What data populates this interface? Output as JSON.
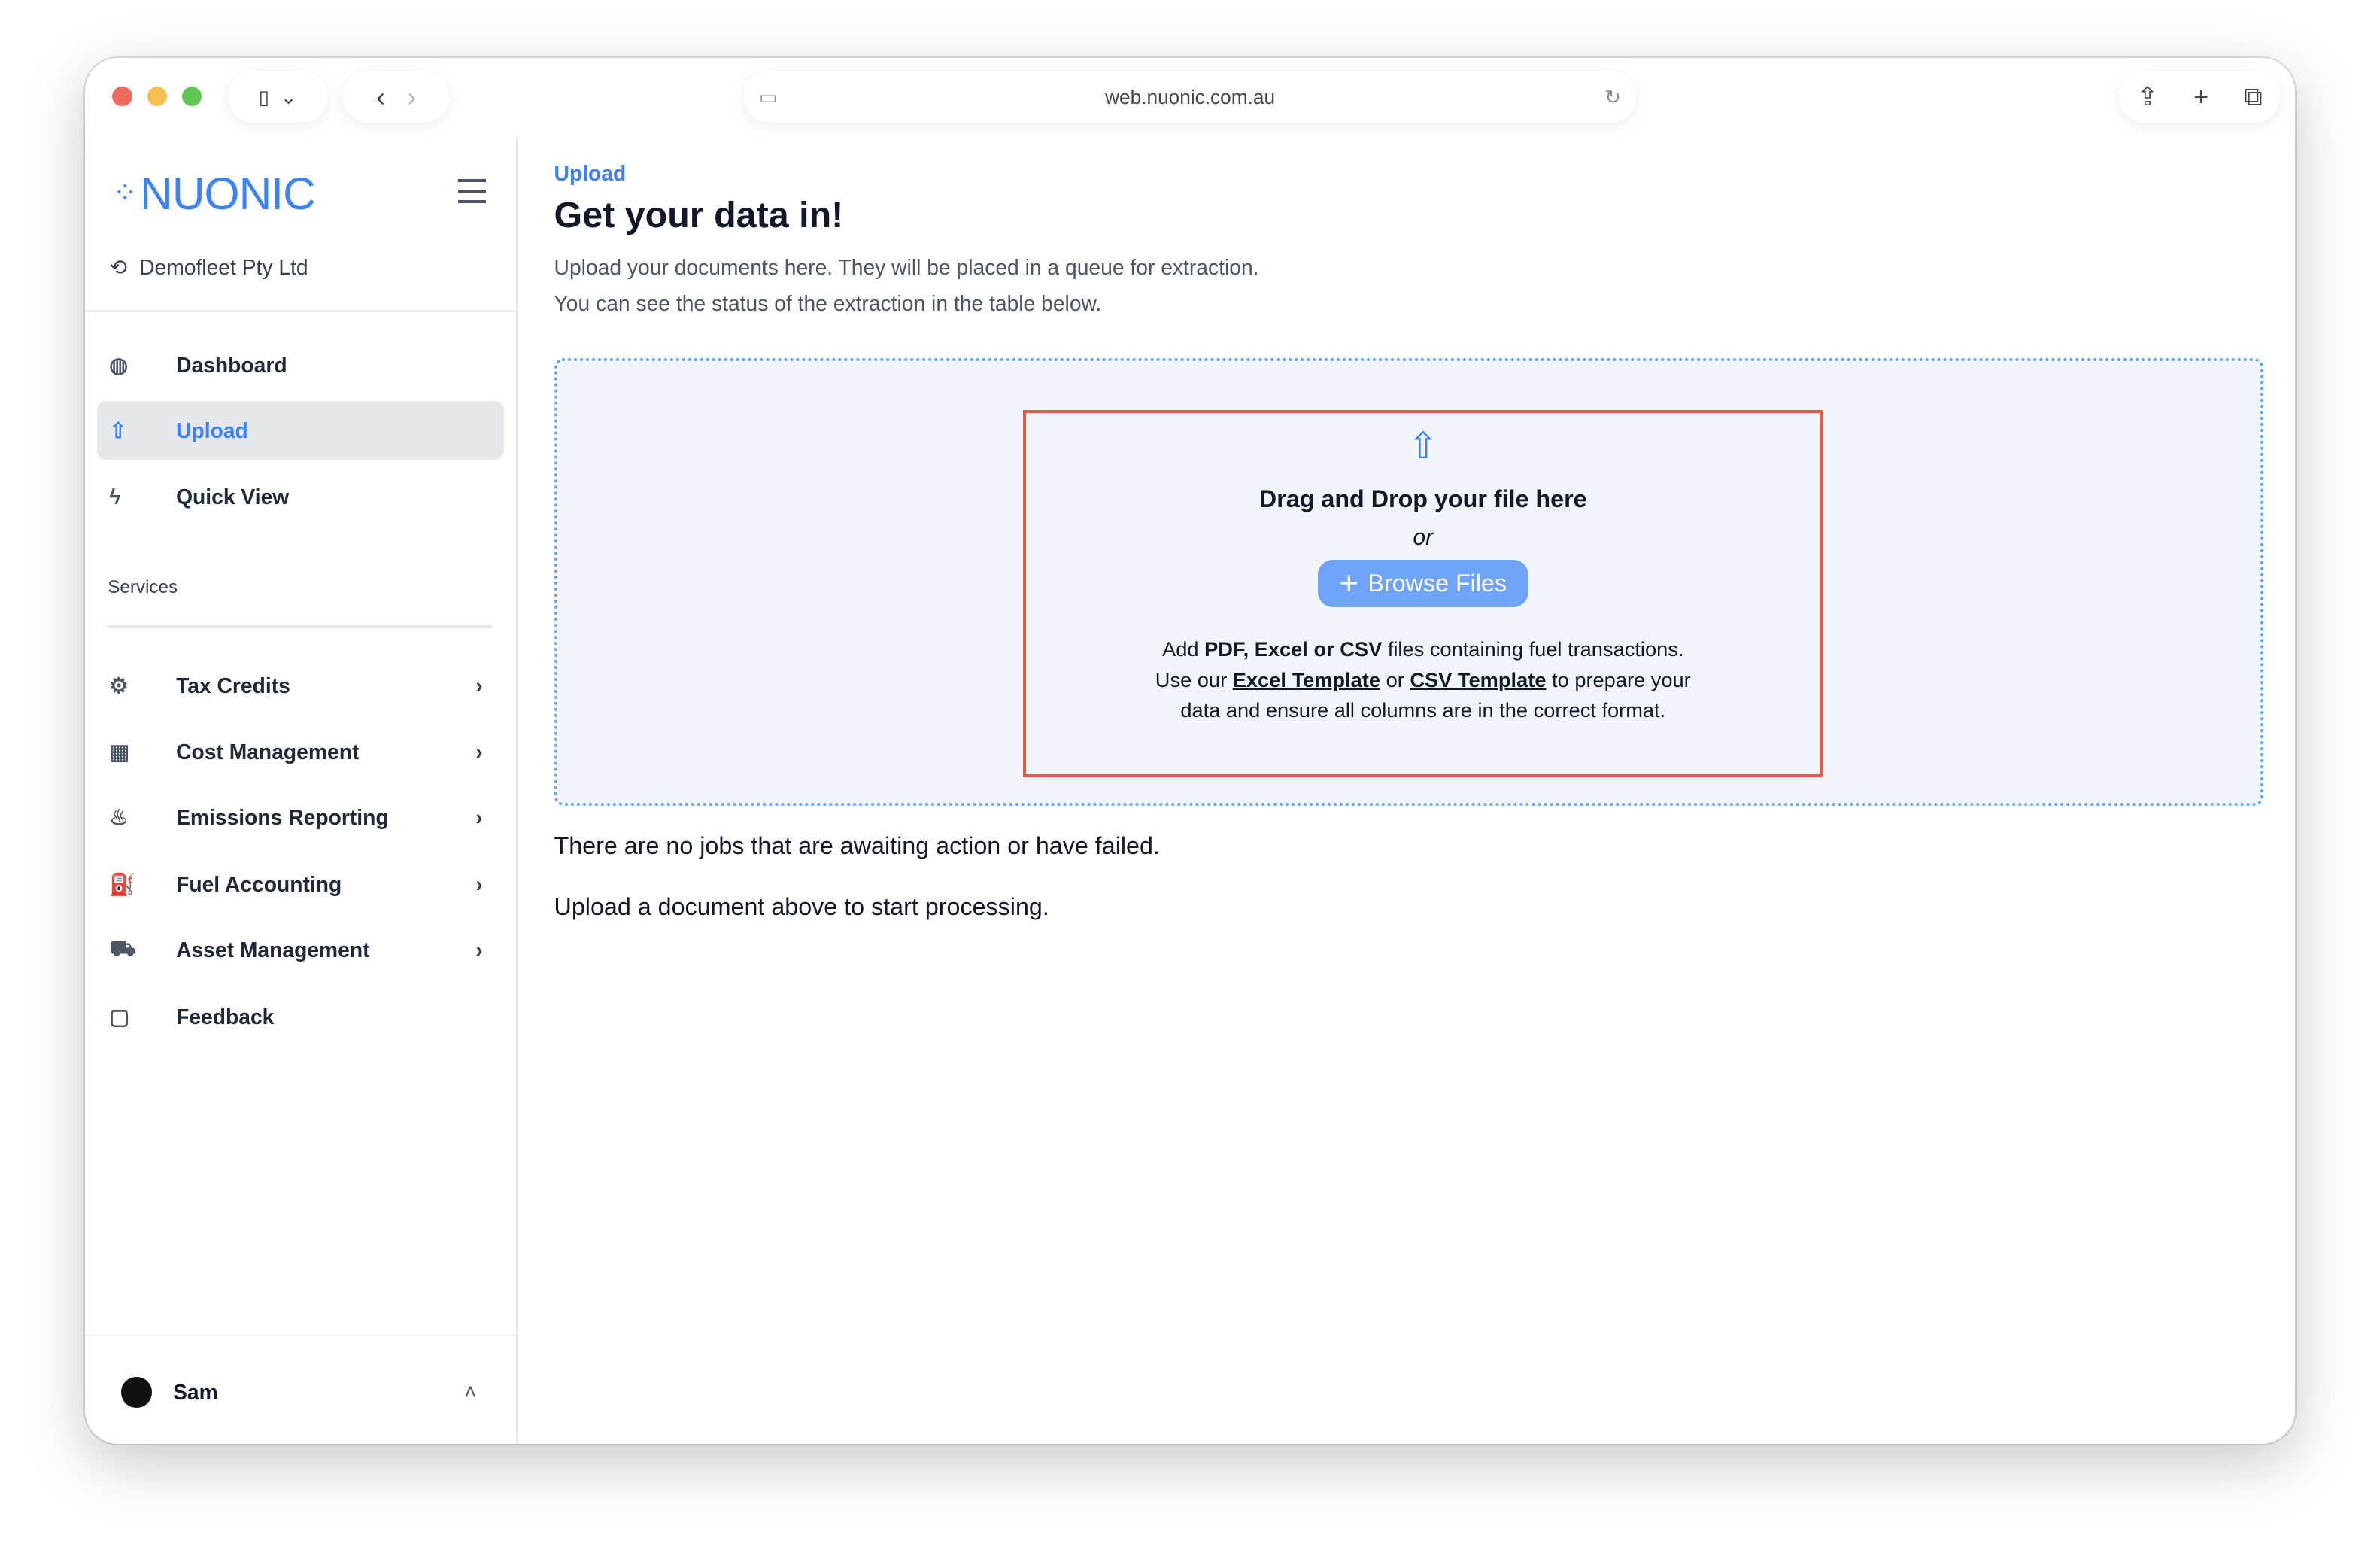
{
  "browser": {
    "url": "web.nuonic.com.au"
  },
  "sidebar": {
    "brand": "NUONIC",
    "org": "Demofleet Pty Ltd",
    "items": [
      {
        "label": "Dashboard"
      },
      {
        "label": "Upload"
      },
      {
        "label": "Quick View"
      }
    ],
    "services_heading": "Services",
    "services": [
      {
        "label": "Tax Credits"
      },
      {
        "label": "Cost Management"
      },
      {
        "label": "Emissions Reporting"
      },
      {
        "label": "Fuel Accounting"
      },
      {
        "label": "Asset Management"
      },
      {
        "label": "Feedback"
      }
    ],
    "user": "Sam"
  },
  "main": {
    "breadcrumb": "Upload",
    "title": "Get your data in!",
    "desc1": "Upload your documents here. They will be placed in a queue for extraction.",
    "desc2": "You can see the status of the extraction in the table below.",
    "drop_title": "Drag and Drop your file here",
    "or": "or",
    "browse": "Browse Files",
    "help_add": "Add ",
    "help_types": "PDF, Excel or CSV",
    "help_rest": " files containing fuel transactions.",
    "help_use": "Use our ",
    "excel_link": "Excel Template",
    "help_or": " or ",
    "csv_link": "CSV Template",
    "help_prep": " to prepare your",
    "help_line3": "data and ensure all columns are in the correct format.",
    "no_jobs": "There are no jobs that are awaiting action or have failed.",
    "start": "Upload a document above to start processing."
  }
}
